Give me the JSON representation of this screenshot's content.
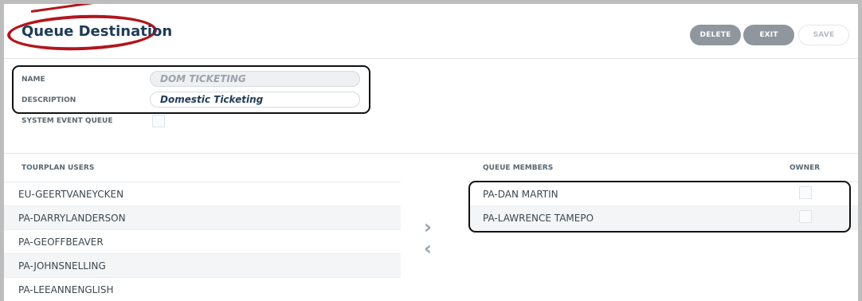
{
  "header": {
    "title": "Queue Destination",
    "buttons": {
      "delete": "DELETE",
      "exit": "EXIT",
      "save": "SAVE"
    }
  },
  "form": {
    "name_label": "NAME",
    "name_value": "DOM TICKETING",
    "description_label": "DESCRIPTION",
    "description_value": "Domestic Ticketing",
    "system_event_label": "SYSTEM EVENT QUEUE",
    "system_event_checked": false
  },
  "users_panel": {
    "header": "TOURPLAN USERS",
    "items": [
      "EU-GEERTVANEYCKEN",
      "PA-DARRYLANDERSON",
      "PA-GEOFFBEAVER",
      "PA-JOHNSNELLING",
      "PA-LEEANNENGLISH"
    ]
  },
  "transfer": {
    "add_icon": "chevron-right-icon",
    "remove_icon": "chevron-left-icon"
  },
  "members_panel": {
    "header": "QUEUE MEMBERS",
    "owner_header": "OWNER",
    "items": [
      {
        "name": "PA-DAN MARTIN",
        "owner": false
      },
      {
        "name": "PA-LAWRENCE TAMEPO",
        "owner": false
      }
    ]
  },
  "colors": {
    "annotation_red": "#b1161c",
    "title": "#1f3a57",
    "button_dark": "#8f969d"
  }
}
